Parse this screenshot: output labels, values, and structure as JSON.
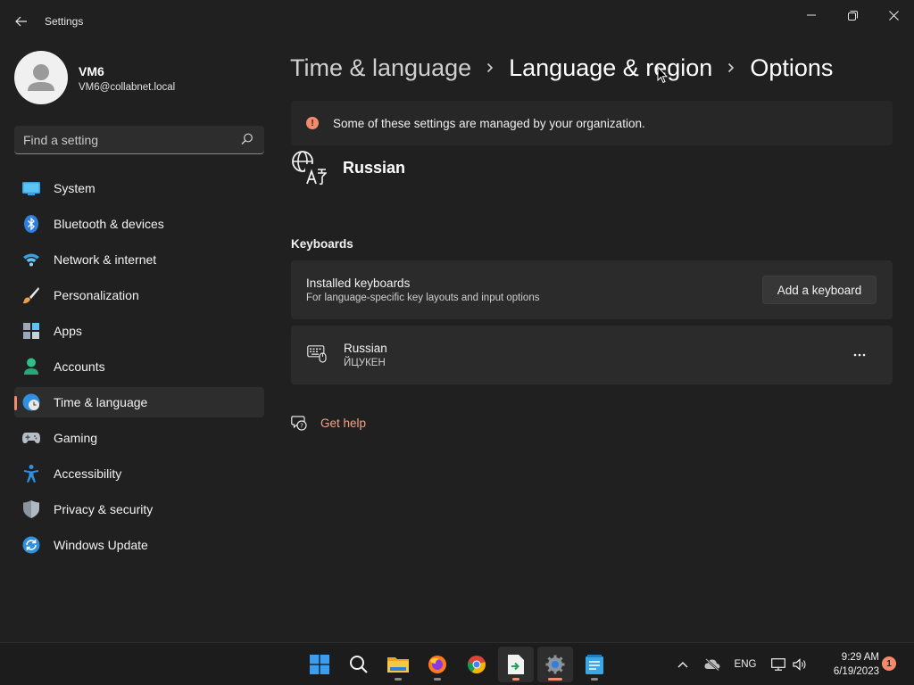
{
  "window": {
    "title": "Settings",
    "controls": [
      "minimize",
      "restore",
      "close"
    ]
  },
  "user": {
    "name": "VM6",
    "email": "VM6@collabnet.local"
  },
  "search": {
    "placeholder": "Find a setting"
  },
  "sidebar": {
    "items": [
      {
        "label": "System",
        "icon": "system-icon"
      },
      {
        "label": "Bluetooth & devices",
        "icon": "bluetooth-icon"
      },
      {
        "label": "Network & internet",
        "icon": "wifi-icon"
      },
      {
        "label": "Personalization",
        "icon": "brush-icon"
      },
      {
        "label": "Apps",
        "icon": "apps-icon"
      },
      {
        "label": "Accounts",
        "icon": "accounts-icon"
      },
      {
        "label": "Time & language",
        "icon": "time-language-icon",
        "selected": true
      },
      {
        "label": "Gaming",
        "icon": "gamepad-icon"
      },
      {
        "label": "Accessibility",
        "icon": "accessibility-icon"
      },
      {
        "label": "Privacy & security",
        "icon": "shield-icon"
      },
      {
        "label": "Windows Update",
        "icon": "update-icon"
      }
    ]
  },
  "breadcrumb": {
    "items": [
      "Time & language",
      "Language & region",
      "Options"
    ]
  },
  "notice": {
    "text": "Some of these settings are managed by your organization."
  },
  "language": {
    "title": "Russian"
  },
  "keyboards": {
    "section_title": "Keyboards",
    "installed_title": "Installed keyboards",
    "installed_subtitle": "For language-specific key layouts and input options",
    "add_button": "Add a keyboard",
    "list": [
      {
        "name": "Russian",
        "layout": "ЙЦУКЕН"
      }
    ]
  },
  "help": {
    "label": "Get help"
  },
  "taskbar": {
    "apps": [
      "start-icon",
      "search-icon",
      "file-explorer-icon",
      "firefox-icon",
      "chrome-icon",
      "file-transfer-icon",
      "settings-icon",
      "notepad-icon"
    ],
    "language": "ENG",
    "time": "9:29 AM",
    "date": "6/19/2023",
    "notification_count": "1"
  },
  "colors": {
    "accent": "#f28a6b",
    "background": "#202020",
    "card": "#2b2b2b"
  }
}
